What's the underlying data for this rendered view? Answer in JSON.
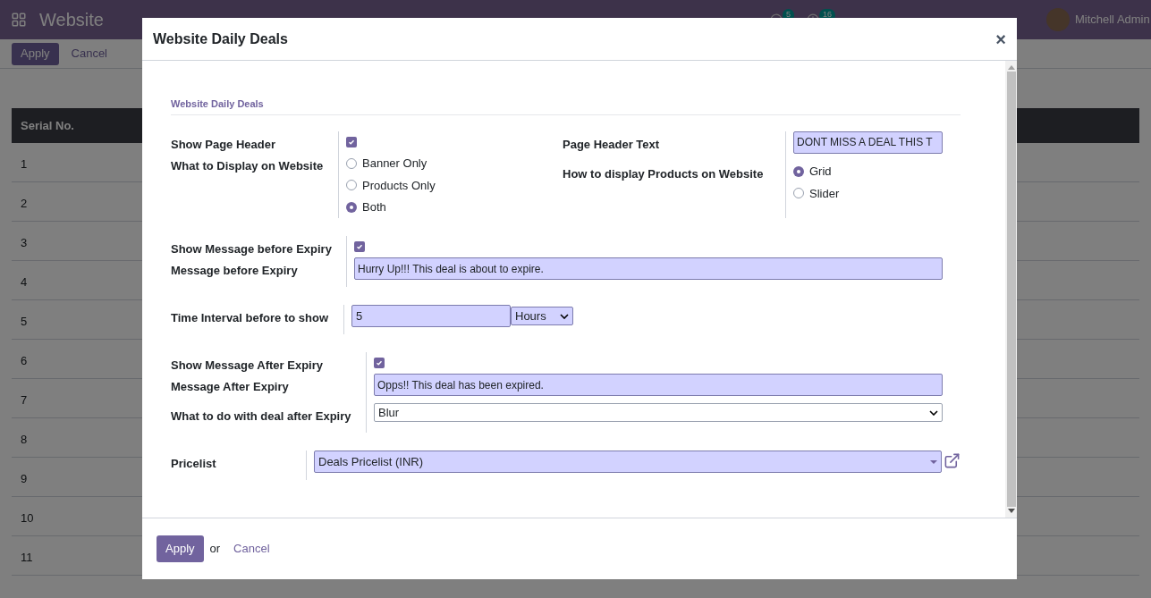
{
  "navbar": {
    "app_title": "Website",
    "badges": [
      {
        "kind": "chat",
        "count": "5"
      },
      {
        "kind": "activity",
        "count": "16"
      }
    ],
    "user": "Mitchell Admin"
  },
  "control_panel": {
    "apply": "Apply",
    "cancel": "Cancel"
  },
  "table": {
    "columns": [
      "Serial No."
    ],
    "rows": [
      {
        "serial": "1"
      },
      {
        "serial": "2"
      },
      {
        "serial": "3"
      },
      {
        "serial": "4"
      },
      {
        "serial": "5"
      },
      {
        "serial": "6"
      },
      {
        "serial": "7"
      },
      {
        "serial": "8"
      },
      {
        "serial": "9"
      },
      {
        "serial": "10"
      },
      {
        "serial": "11"
      }
    ]
  },
  "modal": {
    "title": "Website Daily Deals",
    "close": "×",
    "section_title": "Website Daily Deals",
    "groups": [
      {
        "columns": [
          [
            {
              "kind": "checkbox",
              "label": "Show Page Header",
              "checked": true
            },
            {
              "kind": "radio",
              "label": "What to Display on Website",
              "options": [
                {
                  "label": "Banner Only",
                  "selected": false
                },
                {
                  "label": "Products Only",
                  "selected": false
                },
                {
                  "label": "Both",
                  "selected": true
                }
              ]
            }
          ],
          [
            {
              "kind": "text",
              "label": "Page Header Text",
              "value": "DONT MISS A DEAL THIS T"
            },
            {
              "kind": "radio",
              "label": "How to display Products on Website",
              "options": [
                {
                  "label": "Grid",
                  "selected": true
                },
                {
                  "label": "Slider",
                  "selected": false
                }
              ]
            }
          ]
        ]
      },
      {
        "columns": [
          [
            {
              "kind": "checkbox",
              "label": "Show Message before Expiry",
              "checked": true
            },
            {
              "kind": "text",
              "label": "Message before Expiry",
              "value": "Hurry Up!!! This deal is about to expire."
            }
          ]
        ]
      },
      {
        "columns": [
          [
            {
              "kind": "number_unit",
              "label": "Time Interval before to show",
              "value": "5",
              "unit": "Hours"
            }
          ]
        ]
      },
      {
        "columns": [
          [
            {
              "kind": "checkbox",
              "label": "Show Message After Expiry",
              "checked": true
            },
            {
              "kind": "text",
              "label": "Message After Expiry",
              "value": "Opps!! This deal has been expired."
            },
            {
              "kind": "select",
              "label": "What to do with deal after Expiry",
              "value": "Blur"
            }
          ]
        ]
      },
      {
        "columns": [
          [
            {
              "kind": "many2one",
              "label": "Pricelist",
              "value": "Deals Pricelist (INR)"
            }
          ]
        ]
      }
    ],
    "footer": {
      "apply": "Apply",
      "or": "or",
      "cancel": "Cancel"
    }
  }
}
